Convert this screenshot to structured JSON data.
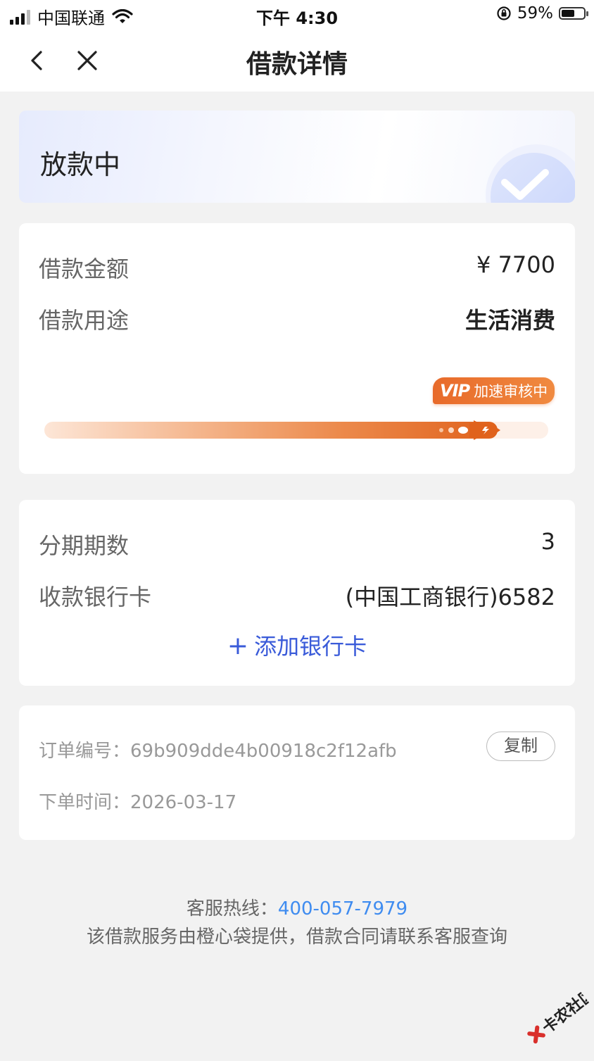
{
  "status_bar": {
    "carrier": "中国联通",
    "time": "下午 4:30",
    "battery": "59%",
    "battery_level": 0.59
  },
  "nav": {
    "title": "借款详情",
    "back_icon": "chevron-left-icon",
    "close_icon": "close-icon"
  },
  "status": {
    "text": "放款中",
    "badge_icon": "check-icon"
  },
  "loan": {
    "amount_label": "借款金额",
    "amount_value": "¥ 7700",
    "purpose_label": "借款用途",
    "purpose_value": "生活消费",
    "vip_logo": "VIP",
    "vip_text": "加速审核中",
    "progress": 0.9
  },
  "installment": {
    "periods_label": "分期期数",
    "periods_value": "3",
    "bank_label": "收款银行卡",
    "bank_value": "(中国工商银行)6582",
    "add_card_plus": "+",
    "add_card_label": "添加银行卡"
  },
  "order": {
    "number_label": "订单编号：",
    "number_value": "69b909dde4b00918c2f12afb",
    "copy_label": "复制",
    "time_label": "下单时间：",
    "time_value": "2026-03-17"
  },
  "footer": {
    "hotline_label": "客服热线：",
    "hotline_number": "400-057-7979",
    "notice": "该借款服务由橙心袋提供，借款合同请联系客服查询"
  },
  "watermark": {
    "text": "卡农社区"
  },
  "colors": {
    "accent_blue": "#3a5bd9",
    "link_blue": "#3f8cf0",
    "vip_orange": "#e86a2a",
    "background": "#f2f2f2"
  }
}
